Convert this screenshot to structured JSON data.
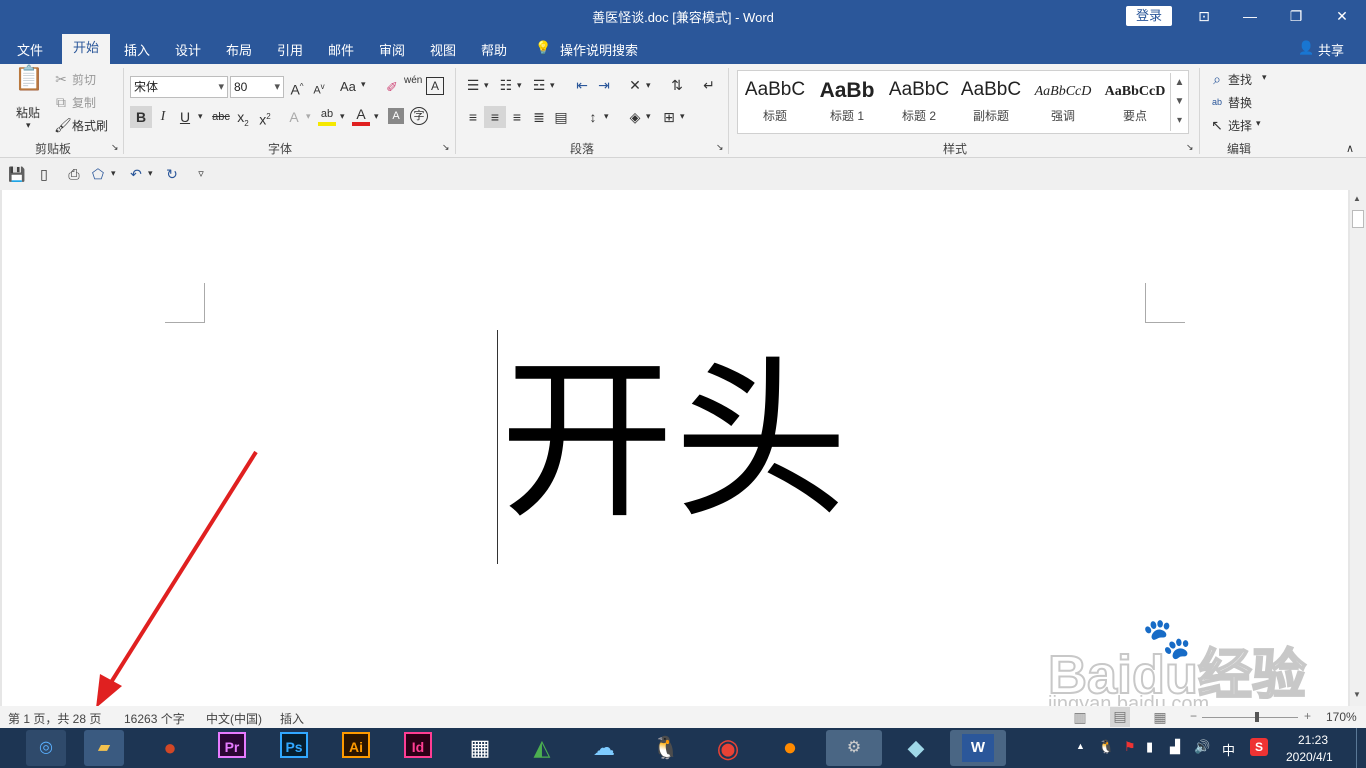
{
  "window": {
    "title": "善医怪谈.doc [兼容模式]  -  Word",
    "login": "登录"
  },
  "tabs": [
    "文件",
    "开始",
    "插入",
    "设计",
    "布局",
    "引用",
    "邮件",
    "审阅",
    "视图",
    "帮助"
  ],
  "tell_me": "操作说明搜索",
  "share": "共享",
  "clipboard": {
    "paste": "粘贴",
    "cut": "剪切",
    "copy": "复制",
    "format_painter": "格式刷",
    "label": "剪贴板"
  },
  "font": {
    "name": "宋体",
    "size": "80",
    "label": "字体",
    "case": "Aa",
    "wen": "wén"
  },
  "paragraph": {
    "label": "段落"
  },
  "styles": {
    "label": "样式",
    "items": [
      {
        "sample": "AaBbC",
        "name": "标题"
      },
      {
        "sample": "AaBb",
        "name": "标题 1"
      },
      {
        "sample": "AaBbC",
        "name": "标题 2"
      },
      {
        "sample": "AaBbC",
        "name": "副标题"
      },
      {
        "sample": "AaBbCcD",
        "name": "强调"
      },
      {
        "sample": "AaBbCcD",
        "name": "要点"
      }
    ]
  },
  "editing": {
    "find": "查找",
    "replace": "替换",
    "select": "选择",
    "label": "编辑"
  },
  "document": {
    "text": "开头"
  },
  "status": {
    "page": "第 1 页，共 28 页",
    "words": "16263 个字",
    "language": "中文(中国)",
    "mode": "插入",
    "zoom": "170%"
  },
  "watermark": {
    "site": "jingyan.baidu.com"
  },
  "taskbar": {
    "time": "21:23",
    "date": "2020/4/1",
    "ime": "中",
    "apps": [
      "Pr",
      "Ps",
      "Ai",
      "Id",
      "W"
    ]
  },
  "colors": {
    "accent": "#2b579a",
    "arrow": "#e02020"
  }
}
